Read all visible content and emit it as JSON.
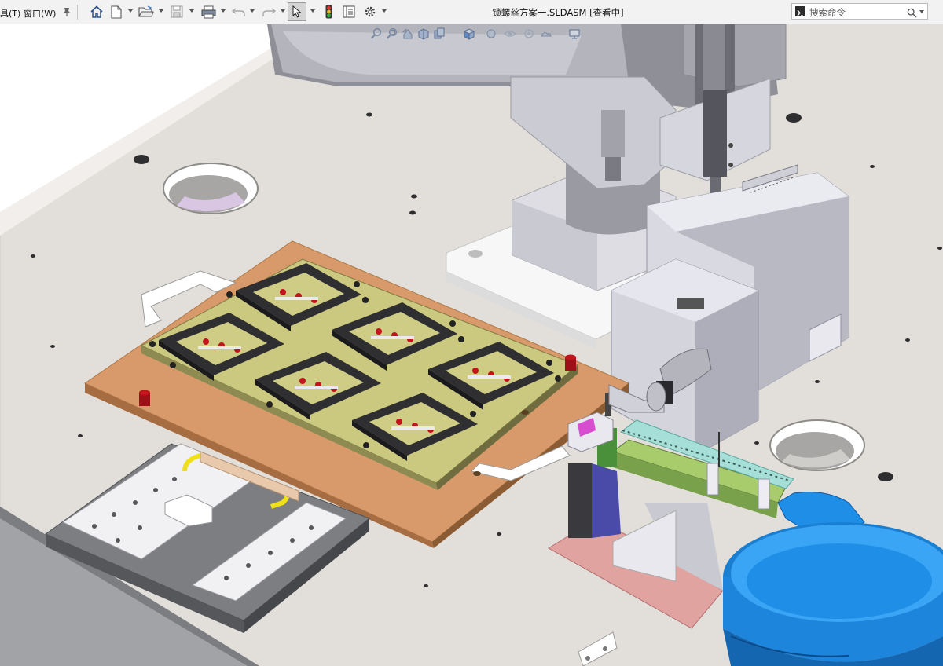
{
  "menubar": {
    "tools_label": "具(T)",
    "window_label": "窗口(W)"
  },
  "toolbar": {
    "items": [
      "home-icon",
      "new-document-icon",
      "open-folder-icon",
      "save-icon",
      "print-icon",
      "undo-icon",
      "redo-icon",
      "select-cursor-icon",
      "rebuild-traffic-light-icon",
      "file-properties-icon",
      "options-gear-icon"
    ]
  },
  "document": {
    "title": "锁螺丝方案一.SLDASM [查看中]"
  },
  "search": {
    "placeholder": "搜索命令"
  },
  "colors": {
    "background": "#ffffff",
    "table_top": "#dfdcd8",
    "fixture_plate": "#d89a6a",
    "adapter_board": "#c9c780",
    "feeder_blue": "#1f8ee6",
    "robot_grey": "#a8a8b0",
    "red_pins": "#c2141c"
  }
}
